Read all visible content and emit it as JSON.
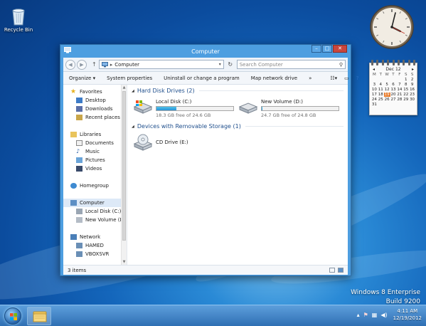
{
  "desktop": {
    "recycle_bin_label": "Recycle Bin",
    "watermark_line1": "Windows 8 Enterprise",
    "watermark_line2": "Build 9200"
  },
  "calendar_gadget": {
    "month_label": "Dec 12",
    "weekday_headers": [
      "M",
      "T",
      "W",
      "T",
      "F",
      "S",
      "S"
    ],
    "days": [
      "",
      "",
      "",
      "",
      "",
      "1",
      "2",
      "3",
      "4",
      "5",
      "6",
      "7",
      "8",
      "9",
      "10",
      "11",
      "12",
      "13",
      "14",
      "15",
      "16",
      "17",
      "18",
      "19",
      "20",
      "21",
      "22",
      "23",
      "24",
      "25",
      "26",
      "27",
      "28",
      "29",
      "30",
      "31",
      "",
      "",
      "",
      "",
      "",
      ""
    ],
    "today": "19",
    "today_color": "#e87b2a"
  },
  "window": {
    "title": "Computer",
    "address": {
      "path": "Computer"
    },
    "search": {
      "placeholder": "Search Computer"
    },
    "toolbar": {
      "organize": "Organize ▾",
      "system_properties": "System properties",
      "uninstall": "Uninstall or change a program",
      "map_drive": "Map network drive",
      "more": "»"
    },
    "nav": {
      "favorites": "Favorites",
      "desktop": "Desktop",
      "downloads": "Downloads",
      "recent_places": "Recent places",
      "libraries": "Libraries",
      "documents": "Documents",
      "music": "Music",
      "pictures": "Pictures",
      "videos": "Videos",
      "homegroup": "Homegroup",
      "computer": "Computer",
      "local_disk": "Local Disk (C:)",
      "new_volume": "New Volume (D:)",
      "network": "Network",
      "hamed": "HAMED",
      "vboxsvr": "VBOXSVR"
    },
    "content": {
      "hard_disk_header": "Hard Disk Drives (2)",
      "removable_header": "Devices with Removable Storage (1)",
      "drives": [
        {
          "name": "Local Disk (C:)",
          "free": "18.3 GB free of 24.6 GB",
          "used_fraction": 0.26
        },
        {
          "name": "New Volume (D:)",
          "free": "24.7 GB free of 24.8 GB",
          "used_fraction": 0.01
        }
      ],
      "cd_drive": "CD Drive (E:)"
    },
    "status": "3 items"
  },
  "taskbar": {
    "time": "4:11 AM",
    "date": "12/19/2012"
  },
  "colors": {
    "accent": "#4d9ee0",
    "drive_bar": "#2892d7",
    "close_button": "#c9463d"
  }
}
